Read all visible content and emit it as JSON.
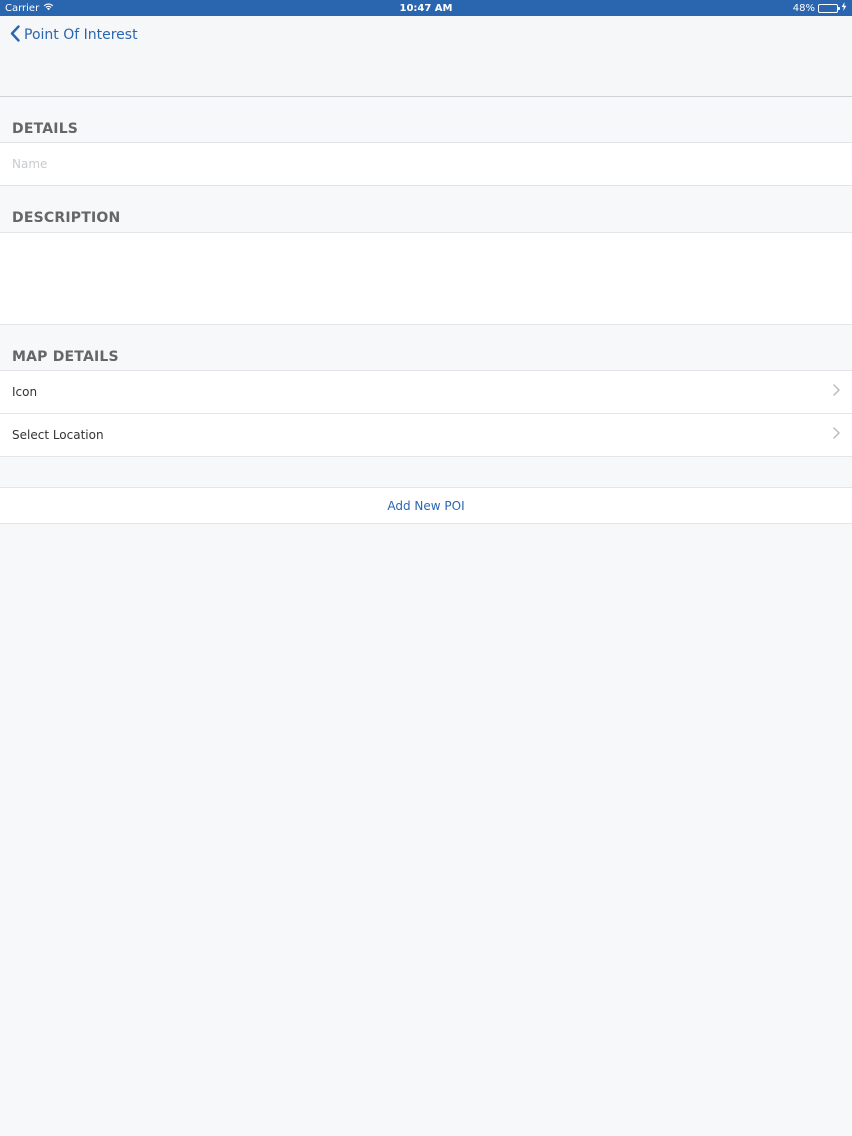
{
  "status_bar": {
    "carrier": "Carrier",
    "time": "10:47 AM",
    "battery_text": "48%",
    "battery_level": 0.48,
    "wifi_icon": "wifi-icon",
    "charging_icon": "bolt-icon"
  },
  "nav": {
    "back_label": "Point Of Interest"
  },
  "sections": {
    "details": {
      "header": "DETAILS",
      "name_placeholder": "Name",
      "name_value": ""
    },
    "description": {
      "header": "DESCRIPTION",
      "value": ""
    },
    "map_details": {
      "header": "MAP DETAILS",
      "icon_label": "Icon",
      "location_label": "Select Location"
    }
  },
  "actions": {
    "add_label": "Add New POI"
  },
  "colors": {
    "accent": "#2a66b0",
    "background": "#f7f8fa",
    "battery_fill": "#4cd964"
  }
}
